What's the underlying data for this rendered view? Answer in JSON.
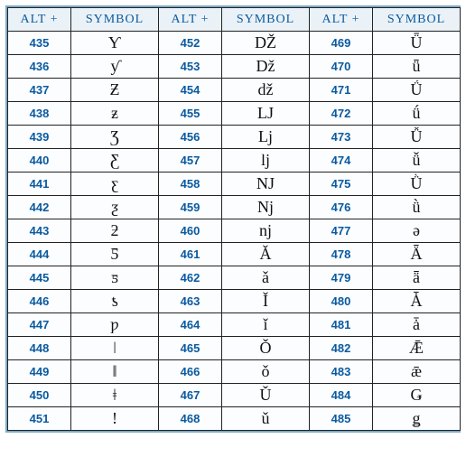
{
  "headers": {
    "alt": "ALT +",
    "symbol": "SYMBOL"
  },
  "chart_data": {
    "type": "table",
    "title": "ALT + SYMBOL codes",
    "columns": [
      {
        "col": 1,
        "rows": [
          {
            "code": "435",
            "sym": "Ƴ"
          },
          {
            "code": "436",
            "sym": "ƴ"
          },
          {
            "code": "437",
            "sym": "Ƶ"
          },
          {
            "code": "438",
            "sym": "ƶ"
          },
          {
            "code": "439",
            "sym": "Ʒ"
          },
          {
            "code": "440",
            "sym": "Ƹ"
          },
          {
            "code": "441",
            "sym": "ƹ"
          },
          {
            "code": "442",
            "sym": "ƺ"
          },
          {
            "code": "443",
            "sym": "ƻ"
          },
          {
            "code": "444",
            "sym": "Ƽ"
          },
          {
            "code": "445",
            "sym": "ƽ"
          },
          {
            "code": "446",
            "sym": "ƾ"
          },
          {
            "code": "447",
            "sym": "ƿ"
          },
          {
            "code": "448",
            "sym": "ǀ"
          },
          {
            "code": "449",
            "sym": "ǁ"
          },
          {
            "code": "450",
            "sym": "ǂ"
          },
          {
            "code": "451",
            "sym": "ǃ"
          }
        ]
      },
      {
        "col": 2,
        "rows": [
          {
            "code": "452",
            "sym": "Ǆ"
          },
          {
            "code": "453",
            "sym": "ǅ"
          },
          {
            "code": "454",
            "sym": "ǆ"
          },
          {
            "code": "455",
            "sym": "Ǉ"
          },
          {
            "code": "456",
            "sym": "ǈ"
          },
          {
            "code": "457",
            "sym": "ǉ"
          },
          {
            "code": "458",
            "sym": "Ǌ"
          },
          {
            "code": "459",
            "sym": "ǋ"
          },
          {
            "code": "460",
            "sym": "ǌ"
          },
          {
            "code": "461",
            "sym": "Ǎ"
          },
          {
            "code": "462",
            "sym": "ǎ"
          },
          {
            "code": "463",
            "sym": "Ǐ"
          },
          {
            "code": "464",
            "sym": "ǐ"
          },
          {
            "code": "465",
            "sym": "Ǒ"
          },
          {
            "code": "466",
            "sym": "ǒ"
          },
          {
            "code": "467",
            "sym": "Ǔ"
          },
          {
            "code": "468",
            "sym": "ǔ"
          }
        ]
      },
      {
        "col": 3,
        "rows": [
          {
            "code": "469",
            "sym": "Ǖ"
          },
          {
            "code": "470",
            "sym": "ǖ"
          },
          {
            "code": "471",
            "sym": "Ǘ"
          },
          {
            "code": "472",
            "sym": "ǘ"
          },
          {
            "code": "473",
            "sym": "Ǚ"
          },
          {
            "code": "474",
            "sym": "ǚ"
          },
          {
            "code": "475",
            "sym": "Ǜ"
          },
          {
            "code": "476",
            "sym": "ǜ"
          },
          {
            "code": "477",
            "sym": "ǝ"
          },
          {
            "code": "478",
            "sym": "Ǟ"
          },
          {
            "code": "479",
            "sym": "ǟ"
          },
          {
            "code": "480",
            "sym": "Ǡ"
          },
          {
            "code": "481",
            "sym": "ǡ"
          },
          {
            "code": "482",
            "sym": "Ǣ"
          },
          {
            "code": "483",
            "sym": "ǣ"
          },
          {
            "code": "484",
            "sym": "Ǥ"
          },
          {
            "code": "485",
            "sym": "ǥ"
          }
        ]
      }
    ]
  }
}
